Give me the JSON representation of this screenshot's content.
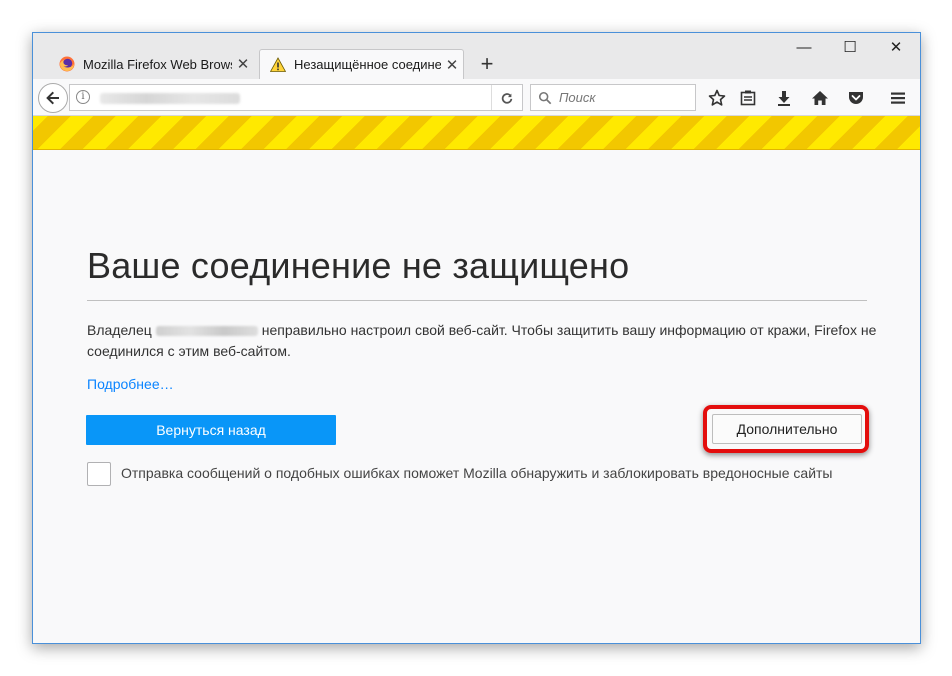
{
  "browser": {
    "tabs": [
      {
        "title": "Mozilla Firefox Web Brows...",
        "icon": "firefox-icon",
        "active": false
      },
      {
        "title": "Незащищённое соедине...",
        "icon": "warning-icon",
        "active": true
      }
    ],
    "window_controls": {
      "minimize": "—",
      "maximize": "☐",
      "close": "✕"
    },
    "search_placeholder": "Поиск",
    "toolbar_icons": [
      "bookmark-star-icon",
      "reading-list-icon",
      "downloads-icon",
      "home-icon",
      "pocket-icon",
      "menu-icon"
    ]
  },
  "error_page": {
    "title": "Ваше соединение не защищено",
    "description_before": "Владелец",
    "description_after": "неправильно настроил свой веб-сайт. Чтобы защитить вашу информацию от кражи, Firefox не соединился с этим веб-сайтом.",
    "learn_more": "Подробнее…",
    "go_back": "Вернуться назад",
    "advanced": "Дополнительно",
    "report_checkbox_label": "Отправка сообщений о подобных ошибках поможет Mozilla обнаружить и заблокировать вредоносные сайты"
  },
  "colors": {
    "accent_button": "#0996f8",
    "link": "#0a84ff",
    "stripe_yellow": "#ffe900",
    "highlight_red": "#e30d0d"
  }
}
